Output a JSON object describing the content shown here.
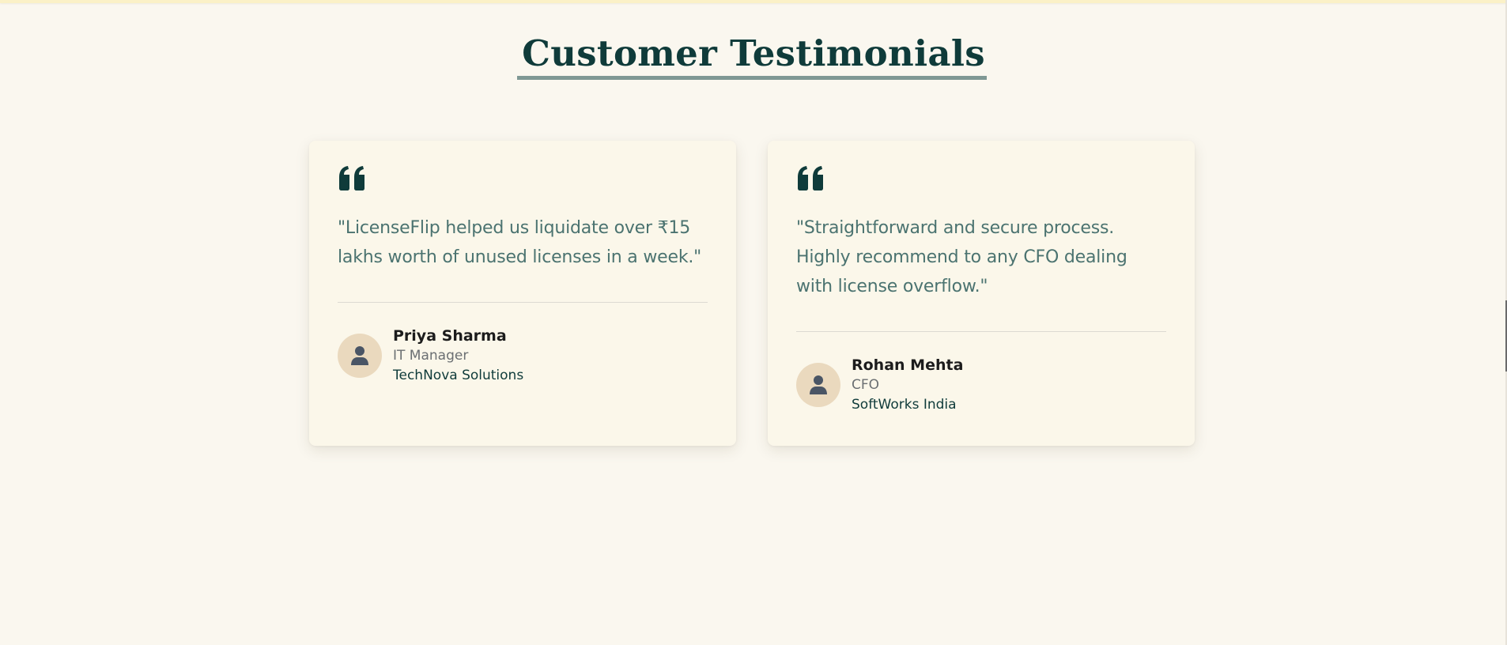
{
  "section": {
    "title": "Customer Testimonials"
  },
  "testimonials": [
    {
      "quote": "\"LicenseFlip helped us liquidate over ₹15 lakhs worth of unused licenses in a week.\"",
      "name": "Priya Sharma",
      "role": "IT Manager",
      "company": "TechNova Solutions"
    },
    {
      "quote": "\"Straightforward and secure process. Highly recommend to any CFO dealing with license overflow.\"",
      "name": "Rohan Mehta",
      "role": "CFO",
      "company": "SoftWorks India"
    }
  ],
  "icons": {
    "quote": "quote-left-icon",
    "avatar": "user-icon"
  },
  "colors": {
    "background": "#faf7ef",
    "card": "#fbf7ea",
    "heading": "#0f3b3a",
    "quote_text": "#4b7370",
    "avatar_bg": "#ead9be",
    "avatar_icon": "#4a5565",
    "underline": "#7f9894"
  }
}
